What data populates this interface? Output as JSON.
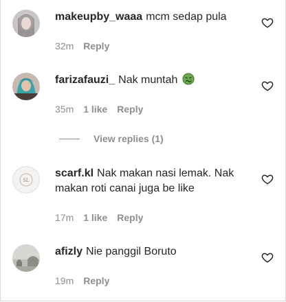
{
  "comments": [
    {
      "username": "makeupby_waaa",
      "text": "mcm sedap pula",
      "time": "32m",
      "likes": "",
      "reply_label": "Reply"
    },
    {
      "username": "farizafauzi_",
      "text": "Nak muntah",
      "emoji": "nauseated-face-emoji",
      "time": "35m",
      "likes": "1 like",
      "reply_label": "Reply",
      "view_replies": "View replies (1)"
    },
    {
      "username": "scarf.kl",
      "text": "Nak makan nasi lemak. Nak makan roti canai juga be like",
      "time": "17m",
      "likes": "1 like",
      "reply_label": "Reply"
    },
    {
      "username": "afizly",
      "text": "Nie panggil Boruto",
      "time": "19m",
      "likes": "",
      "reply_label": "Reply"
    }
  ],
  "icons": {
    "like": "heart-icon"
  },
  "colors": {
    "text": "#262626",
    "secondary": "#8e8e8e",
    "emoji_green": "#6aa84f"
  }
}
